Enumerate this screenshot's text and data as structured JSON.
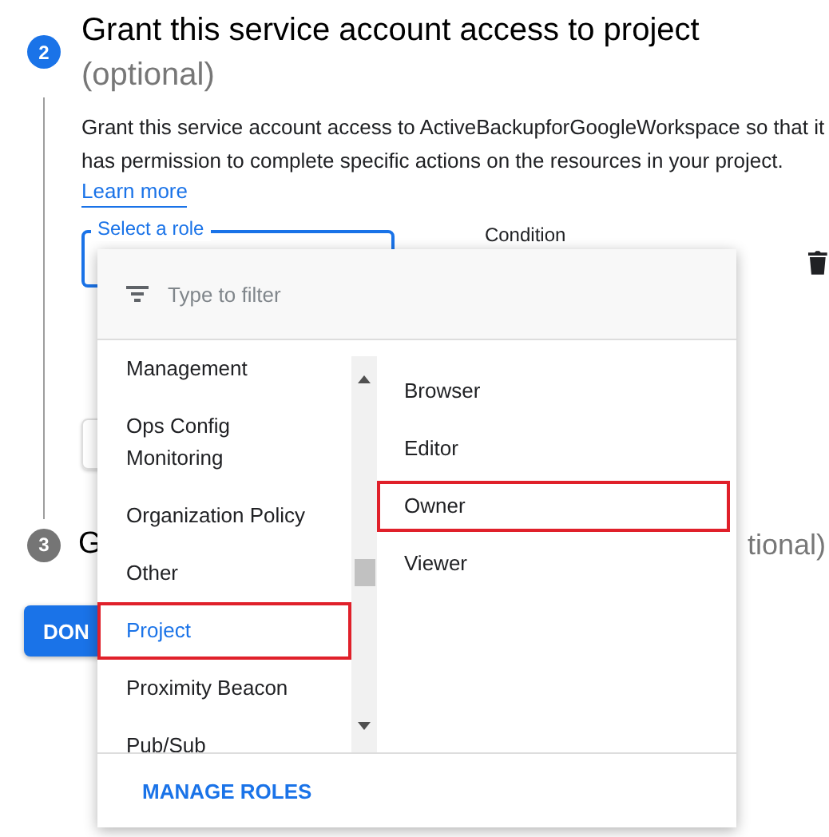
{
  "step2": {
    "number": "2",
    "active": true,
    "title": "Grant this service account access to project",
    "subtitle": "(optional)",
    "description": "Grant this service account access to ActiveBackupforGoogleWorkspace so that it has permission to complete specific actions on the resources in your project.",
    "link": "Learn more"
  },
  "role_field": {
    "label": "Select a role",
    "focused": true
  },
  "condition_label": "Condition",
  "step3": {
    "number": "3",
    "active": false,
    "title_start": "G",
    "title_end": "tional)"
  },
  "done_button": "DON",
  "menu": {
    "filter": {
      "placeholder": "Type to filter"
    },
    "categories": [
      {
        "label": "Management",
        "selected": false,
        "highlighted": false
      },
      {
        "label": "Ops Config Monitoring",
        "selected": false,
        "highlighted": false
      },
      {
        "label": "Organization Policy",
        "selected": false,
        "highlighted": false
      },
      {
        "label": "Other",
        "selected": false,
        "highlighted": false
      },
      {
        "label": "Project",
        "selected": true,
        "highlighted": true
      },
      {
        "label": "Proximity Beacon",
        "selected": false,
        "highlighted": false
      },
      {
        "label": "Pub/Sub",
        "selected": false,
        "highlighted": false
      }
    ],
    "roles": [
      {
        "label": "Browser",
        "highlighted": false
      },
      {
        "label": "Editor",
        "highlighted": false
      },
      {
        "label": "Owner",
        "highlighted": true
      },
      {
        "label": "Viewer",
        "highlighted": false
      }
    ],
    "footer_button": "MANAGE ROLES"
  }
}
